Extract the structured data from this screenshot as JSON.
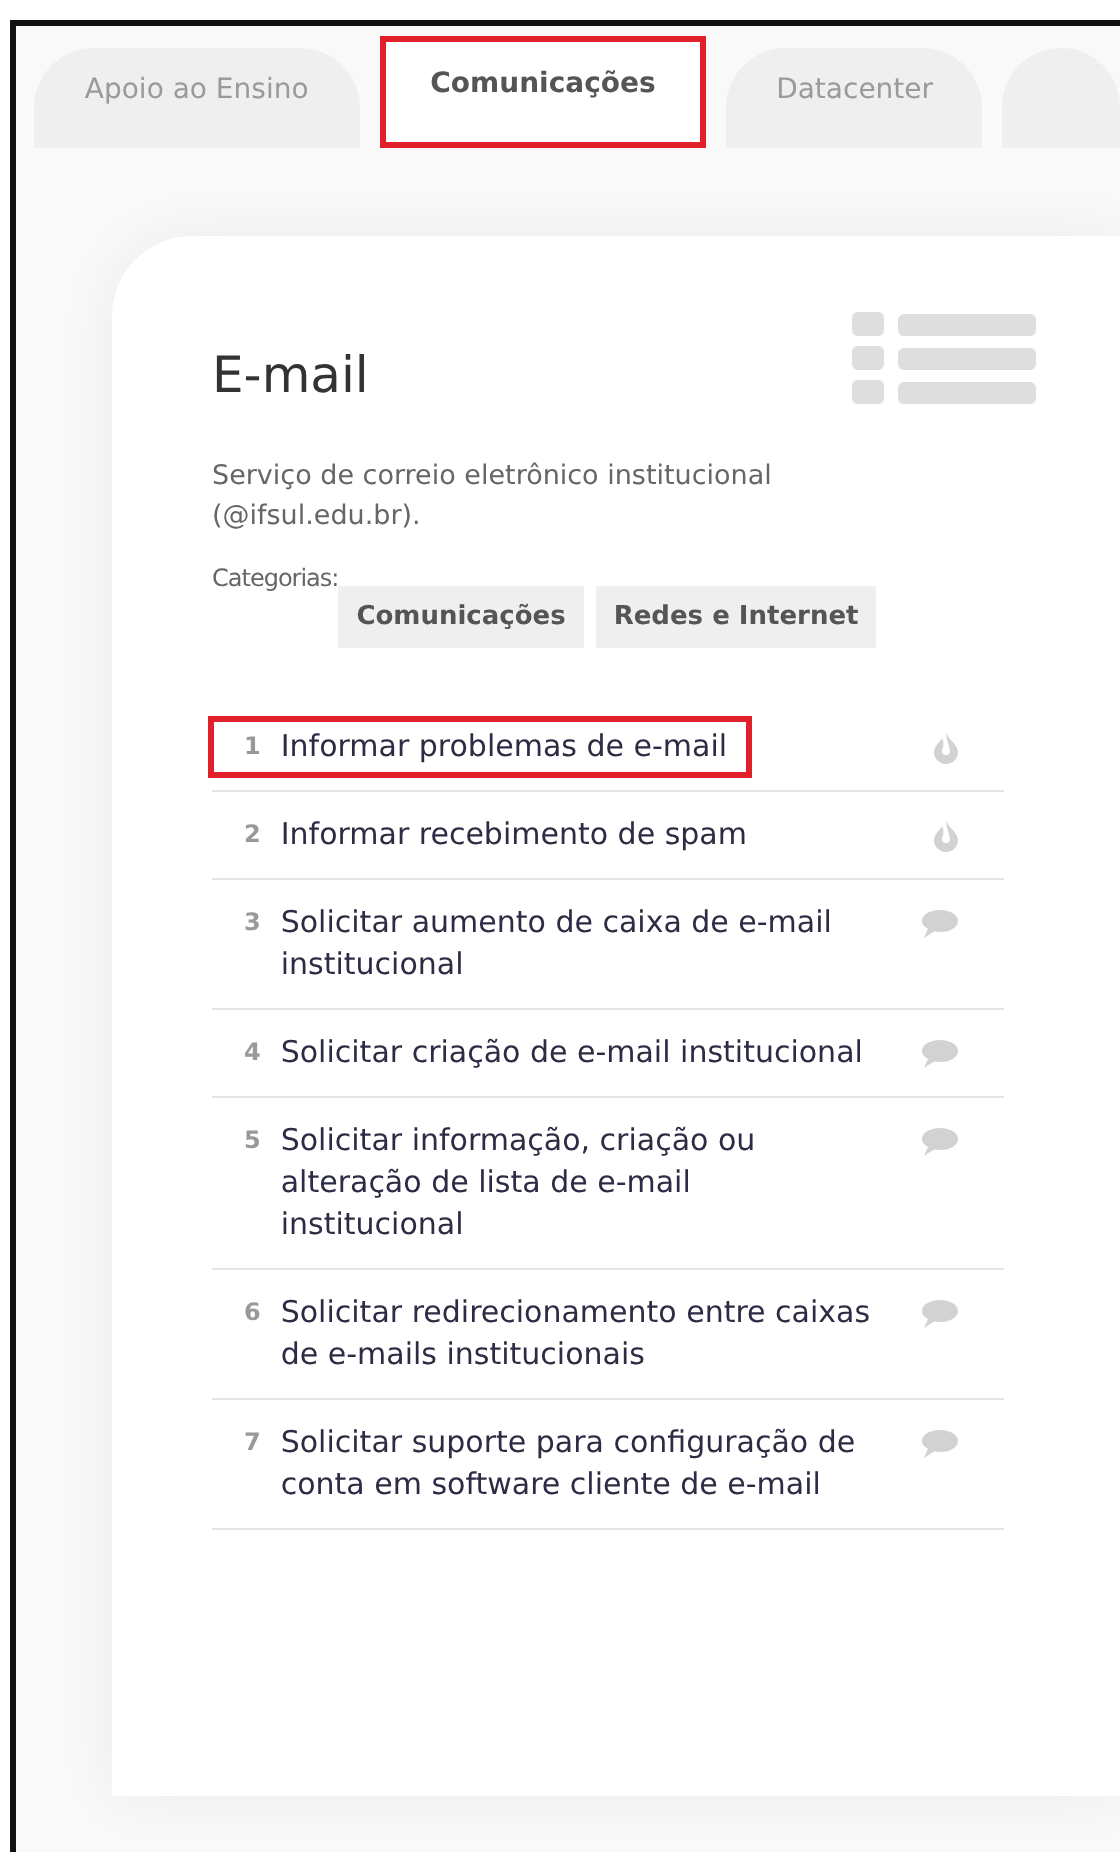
{
  "tabs": [
    {
      "label": "Apoio ao Ensino",
      "selected": false,
      "highlighted": false
    },
    {
      "label": "Comunicações",
      "selected": true,
      "highlighted": true
    },
    {
      "label": "Datacenter",
      "selected": false,
      "highlighted": false
    },
    {
      "selected": false,
      "highlighted": false
    }
  ],
  "service": {
    "title": "E-mail",
    "description": "Serviço de correio eletrônico institucional (@ifsul.edu.br).",
    "categories_label": "Categorias:",
    "categories": [
      "Comunicações",
      "Redes e Internet"
    ]
  },
  "items": [
    {
      "number": "1",
      "text": "Informar problemas de e-mail",
      "kind": "incident",
      "highlighted": true
    },
    {
      "number": "2",
      "text": "Informar recebimento de spam",
      "kind": "incident",
      "highlighted": false
    },
    {
      "number": "3",
      "text": "Solicitar aumento de caixa de e-mail institucional",
      "kind": "request",
      "highlighted": false
    },
    {
      "number": "4",
      "text": "Solicitar criação de e-mail institucional",
      "kind": "request",
      "highlighted": false
    },
    {
      "number": "5",
      "text": "Solicitar informação, criação ou alteração de lista de e-mail institucional",
      "kind": "request",
      "highlighted": false
    },
    {
      "number": "6",
      "text": "Solicitar redirecionamento entre caixas de e-mails institucionais",
      "kind": "request",
      "highlighted": false
    },
    {
      "number": "7",
      "text": "Solicitar suporte para configuração de conta em software cliente de e-mail",
      "kind": "request",
      "highlighted": false
    }
  ]
}
